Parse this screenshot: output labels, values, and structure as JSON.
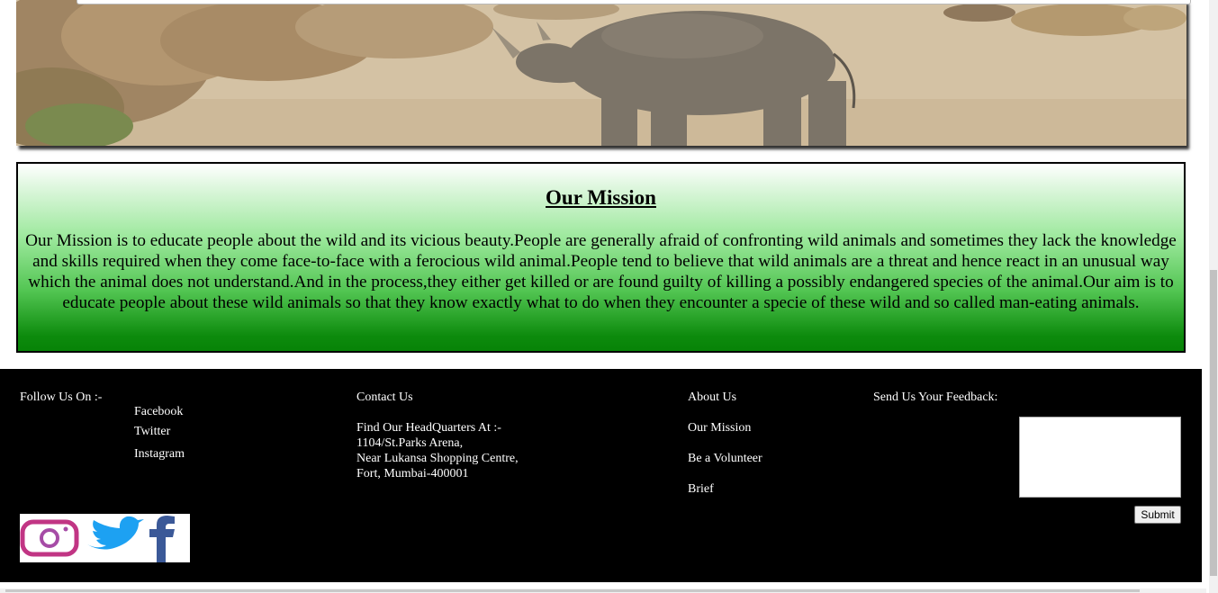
{
  "mission": {
    "title": "Our Mission",
    "text": "Our Mission is to educate people about the wild and its vicious beauty.People are generally afraid of confronting wild animals and sometimes they lack the knowledge and skills required when they come face-to-face with a ferocious wild animal.People tend to believe that wild animals are a threat and hence react in an unusual way which the animal does not understand.And in the process,they either get killed or are found guilty of killing a possibly endangered species of the animal.Our aim is to educate people about these wild animals so that they know exactly what to do when they encounter a specie of these wild and so called man-eating animals."
  },
  "footer": {
    "follow": {
      "heading": "Follow Us On :-",
      "links": [
        "Facebook",
        "Twitter",
        "Instagram"
      ]
    },
    "contact": {
      "heading": "Contact Us",
      "address_heading": "Find Our HeadQuarters At :-",
      "address_lines": [
        "1104/St.Parks Arena,",
        "Near Lukansa Shopping Centre,",
        "Fort, Mumbai-400001"
      ]
    },
    "about": {
      "heading": "About Us",
      "links": [
        "Our Mission",
        "Be a Volunteer",
        "Brief"
      ]
    },
    "feedback": {
      "heading": "Send Us Your Feedback:",
      "textarea_value": "",
      "submit_label": "Submit"
    },
    "social_icons": [
      "instagram-icon",
      "twitter-icon",
      "facebook-icon"
    ]
  },
  "colors": {
    "footer_bg": "#000000",
    "mission_gradient_top": "#ffffff",
    "mission_gradient_bottom": "#078307",
    "twitter_blue": "#1da1f2",
    "facebook_blue": "#3b5998"
  }
}
